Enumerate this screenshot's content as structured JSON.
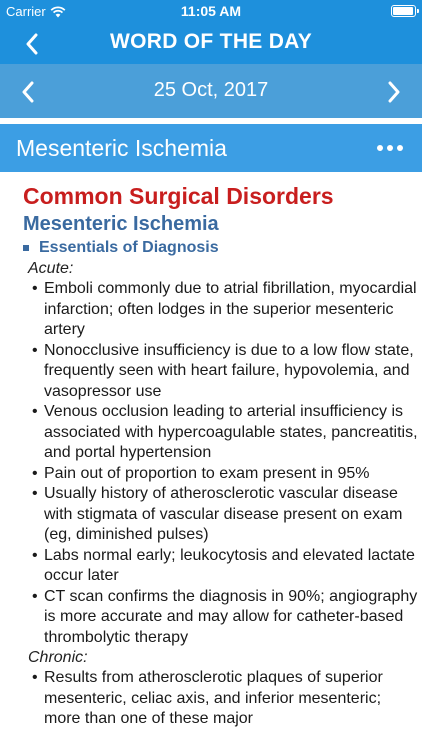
{
  "status_bar": {
    "carrier": "Carrier",
    "time": "11:05 AM",
    "battery_level": 1.0
  },
  "nav": {
    "title": "WORD OF THE DAY",
    "back_icon": "chevron-left-icon"
  },
  "date_bar": {
    "date": "25 Oct, 2017",
    "prev_icon": "chevron-left-icon",
    "next_icon": "chevron-right-icon"
  },
  "term_bar": {
    "term": "Mesenteric Ischemia",
    "more_icon": "more-horizontal-icon"
  },
  "article": {
    "chapter": "Common Surgical Disorders",
    "topic": "Mesenteric Ischemia",
    "section": "Essentials of Diagnosis",
    "acute_label": "Acute:",
    "acute": [
      "Emboli commonly due to atrial fibrillation, myocardial infarction; often lodges in the superior mesenteric artery",
      "Nonocclusive insufficiency is due to a low flow state, frequently seen with heart failure, hypovolemia, and vasopressor use",
      "Venous occlusion leading to arterial insufficiency is associated with hypercoagulable states, pancreatitis, and portal hypertension",
      "Pain out of proportion to exam present in 95%",
      "Usually history of atherosclerotic vascular disease with stigmata of vascular disease present on exam (eg, diminished pulses)",
      "Labs normal early; leukocytosis and elevated lactate occur later",
      "CT scan confirms the diagnosis in 90%; angiography is more accurate and may allow for catheter-based thrombolytic therapy"
    ],
    "chronic_label": "Chronic:",
    "chronic": [
      "Results from atherosclerotic plaques of superior mesenteric, celiac axis, and inferior mesenteric; more than one of these major"
    ]
  },
  "colors": {
    "nav_bg": "#1e90dc",
    "date_bg": "#4b9fd9",
    "term_bg": "#3c9ee4",
    "chapter": "#c81e1e",
    "topic": "#3a6aa0"
  }
}
